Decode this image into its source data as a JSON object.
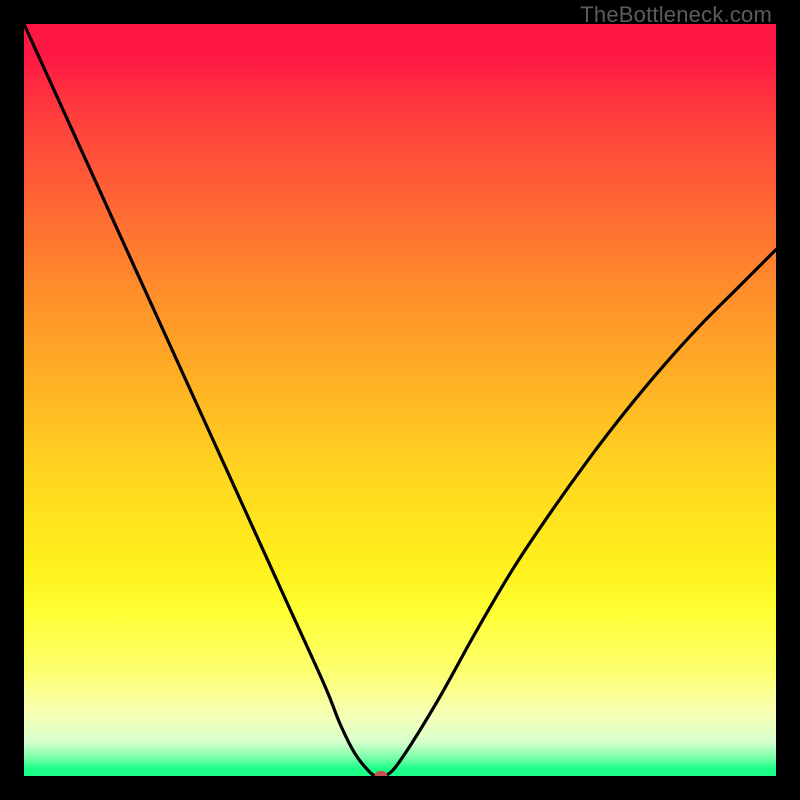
{
  "watermark": "TheBottleneck.com",
  "chart_data": {
    "type": "line",
    "title": "",
    "xlabel": "",
    "ylabel": "",
    "xlim": [
      0,
      100
    ],
    "ylim": [
      0,
      100
    ],
    "series": [
      {
        "name": "bottleneck-curve",
        "x": [
          0,
          5,
          10,
          15,
          20,
          25,
          30,
          35,
          40,
          42,
          44,
          46,
          47,
          48,
          50,
          55,
          60,
          65,
          70,
          75,
          80,
          85,
          90,
          95,
          100
        ],
        "values": [
          100,
          89,
          78,
          67,
          56,
          45,
          34,
          23,
          12,
          7,
          3,
          0.5,
          0,
          0,
          2,
          10,
          19,
          27.5,
          35,
          42,
          48.5,
          54.5,
          60,
          65,
          70
        ]
      }
    ],
    "marker": {
      "x": 47.5,
      "y": 0
    },
    "background_gradient": {
      "top": "#ff1744",
      "mid": "#fff01c",
      "bottom": "#1dff88"
    }
  },
  "colors": {
    "frame": "#000000",
    "curve": "#000000",
    "marker": "#c25450"
  }
}
